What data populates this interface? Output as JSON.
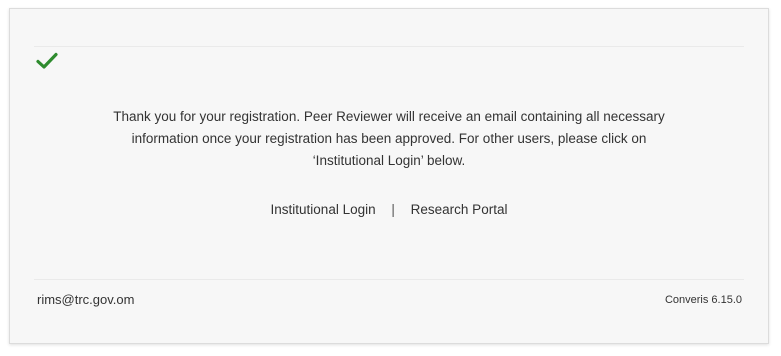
{
  "status": {
    "icon": "checkmark-icon",
    "color": "#2e8b2e"
  },
  "message": {
    "line1": "Thank you for your registration. Peer Reviewer will receive an email containing all necessary",
    "line2": "information once your registration has been approved. For other users, please click on",
    "line3": "‘Institutional Login’ below."
  },
  "links": {
    "institutional_login": "Institutional Login",
    "separator": "|",
    "research_portal": "Research Portal"
  },
  "footer": {
    "email": "rims@trc.gov.om",
    "version": "Converis 6.15.0"
  }
}
